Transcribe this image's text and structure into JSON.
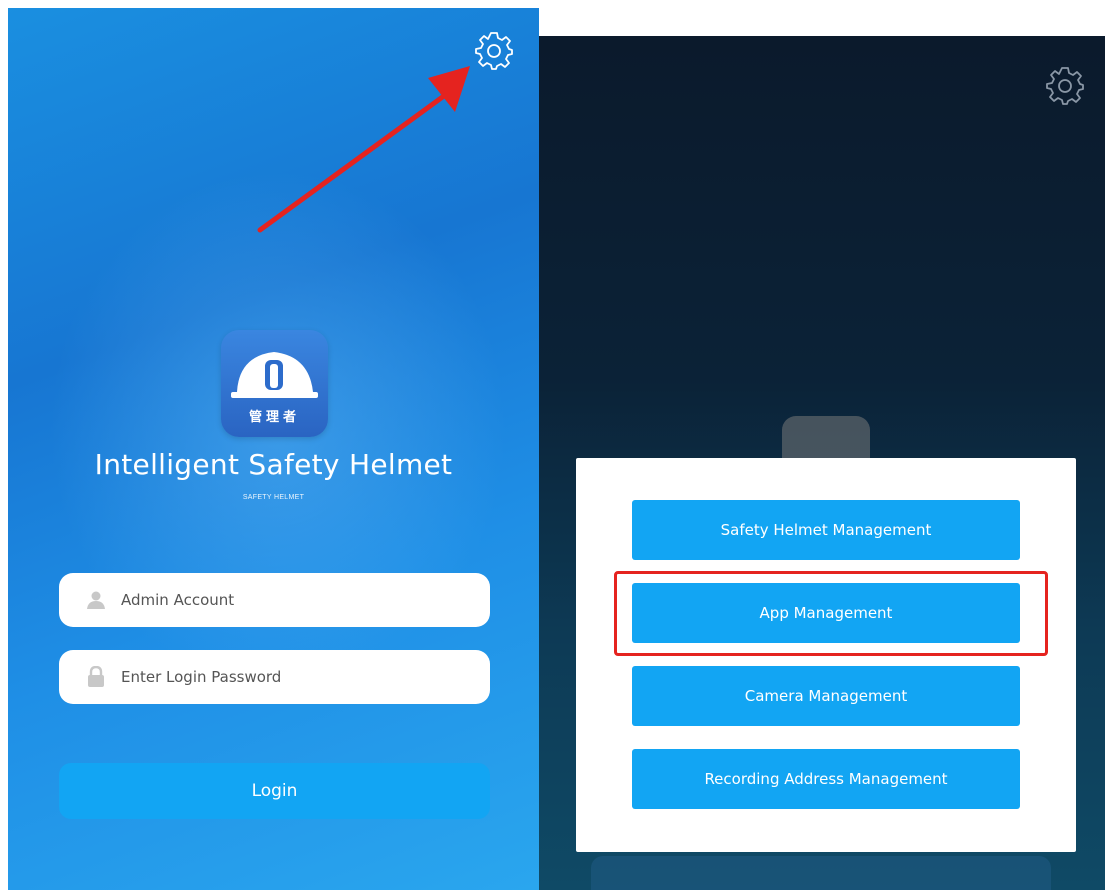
{
  "login_screen": {
    "logo_text": "管理者",
    "title": "Intelligent Safety Helmet",
    "subtitle": "SAFETY HELMET",
    "account_placeholder": "Admin Account",
    "password_placeholder": "Enter Login Password",
    "login_label": "Login",
    "icons": {
      "settings": "gear-icon",
      "account": "user-icon",
      "password": "lock-icon",
      "logo": "helmet-icon"
    }
  },
  "settings_screen": {
    "menu": [
      {
        "label": "Safety Helmet Management"
      },
      {
        "label": "App Management"
      },
      {
        "label": "Camera Management"
      },
      {
        "label": "Recording Address Management"
      }
    ],
    "highlighted_item": "App Management"
  },
  "colors": {
    "primary_blue": "#12a5f3",
    "annotation_red": "#e5231f",
    "logo_blue": "#2a64c2"
  }
}
